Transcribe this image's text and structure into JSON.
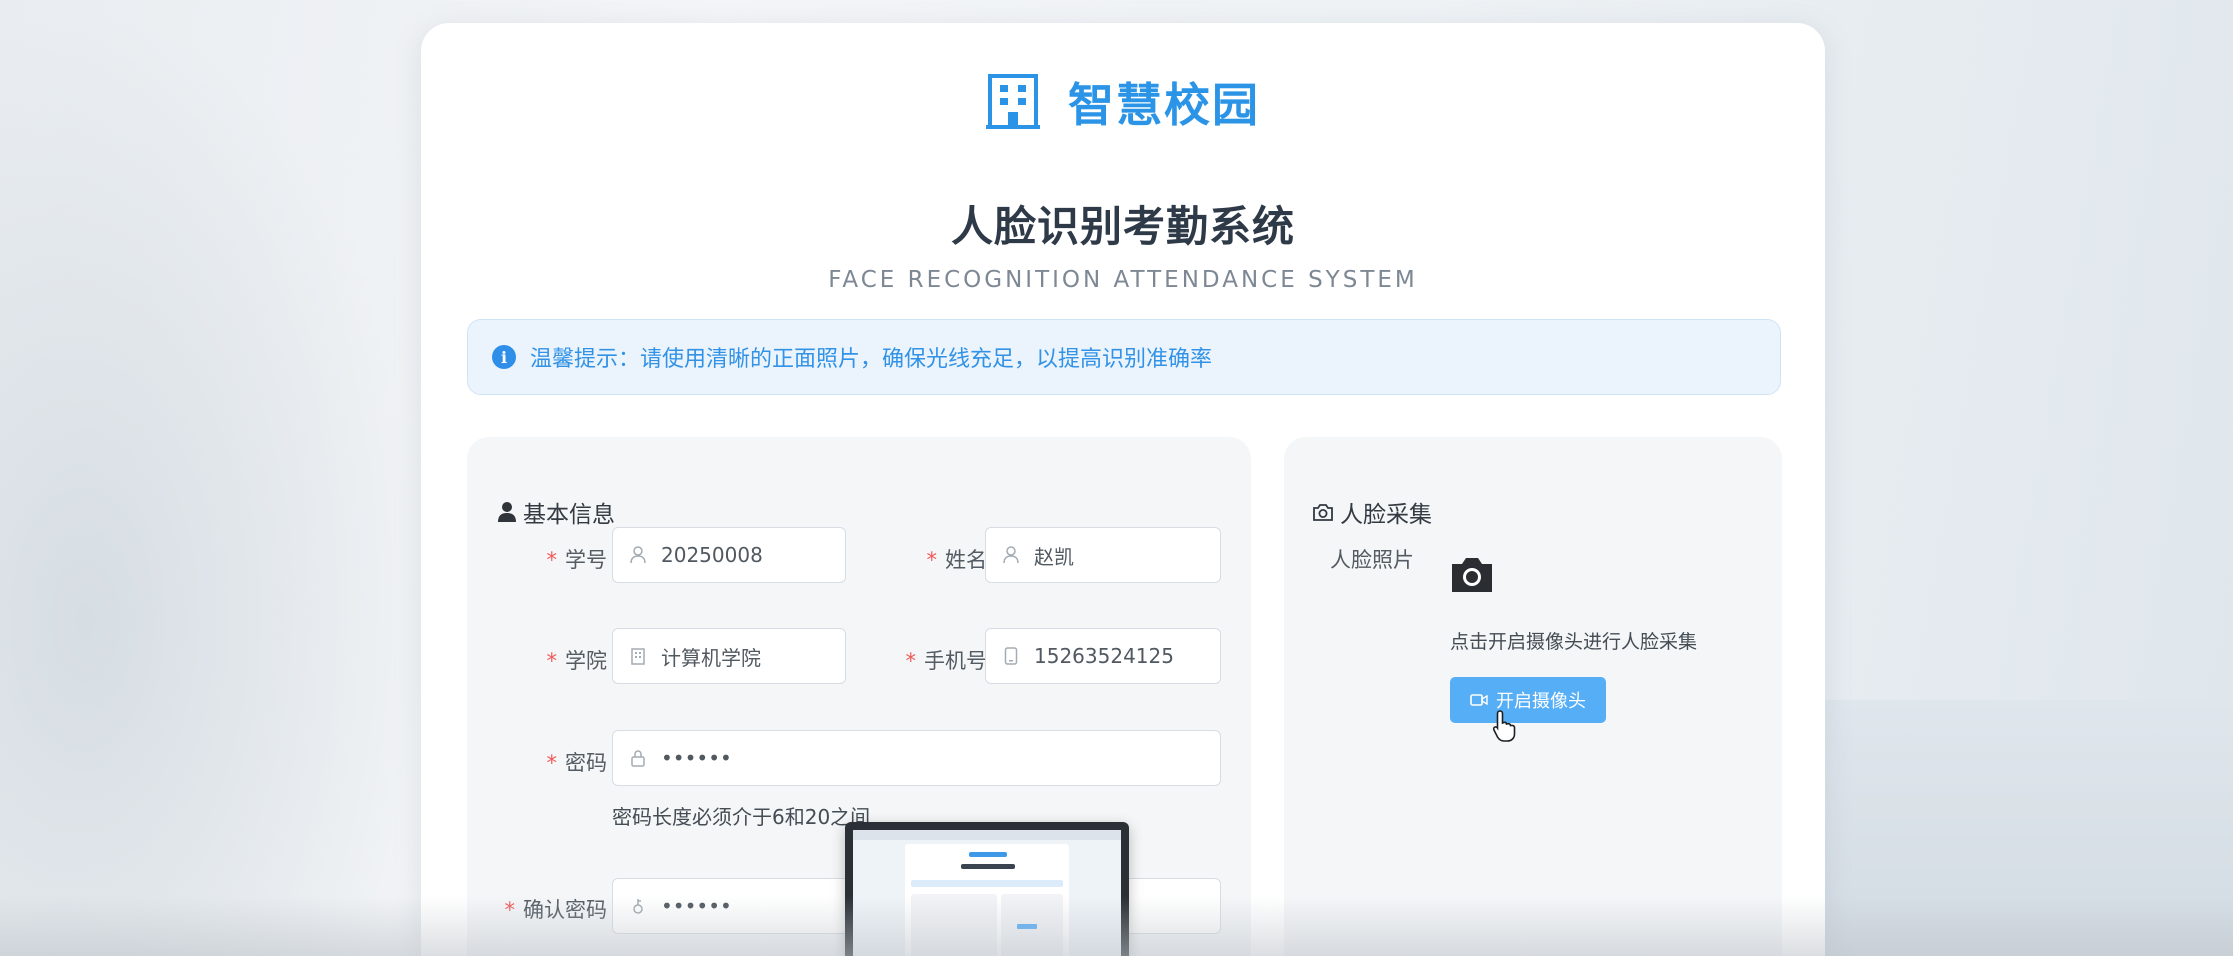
{
  "brand": {
    "name": "智慧校园",
    "icon": "building-icon"
  },
  "header": {
    "title": "人脸识别考勤系统",
    "subtitle": "FACE RECOGNITION ATTENDANCE SYSTEM"
  },
  "alert": {
    "icon": "info-icon",
    "text": "温馨提示：请使用清晰的正面照片，确保光线充足，以提高识别准确率"
  },
  "basic_info": {
    "heading": "基本信息",
    "heading_icon": "user-icon",
    "fields": {
      "student_id": {
        "label": "学号",
        "value": "20250008",
        "icon": "user-icon"
      },
      "name": {
        "label": "姓名",
        "value": "赵凯",
        "icon": "user-icon"
      },
      "college": {
        "label": "学院",
        "value": "计算机学院",
        "icon": "building-small-icon"
      },
      "phone": {
        "label": "手机号",
        "value": "15263524125",
        "icon": "phone-icon"
      },
      "password": {
        "label": "密码",
        "value": "••••••",
        "icon": "lock-icon",
        "hint": "密码长度必须介于6和20之间"
      },
      "confirm_password": {
        "label": "确认密码",
        "value": "••••••",
        "icon": "key-icon"
      }
    },
    "required_mark": "*"
  },
  "face_capture": {
    "heading": "人脸采集",
    "heading_icon": "camera-outline-icon",
    "photo_label": "人脸照片",
    "camera_icon": "camera-icon",
    "tip": "点击开启摄像头进行人脸采集",
    "button_label": "开启摄像头",
    "button_icon": "video-icon"
  },
  "colors": {
    "accent": "#2b94e6",
    "button": "#56aef7",
    "alert_bg": "#ebf4fd",
    "required": "#f05a5a",
    "title": "#2e3a47"
  }
}
